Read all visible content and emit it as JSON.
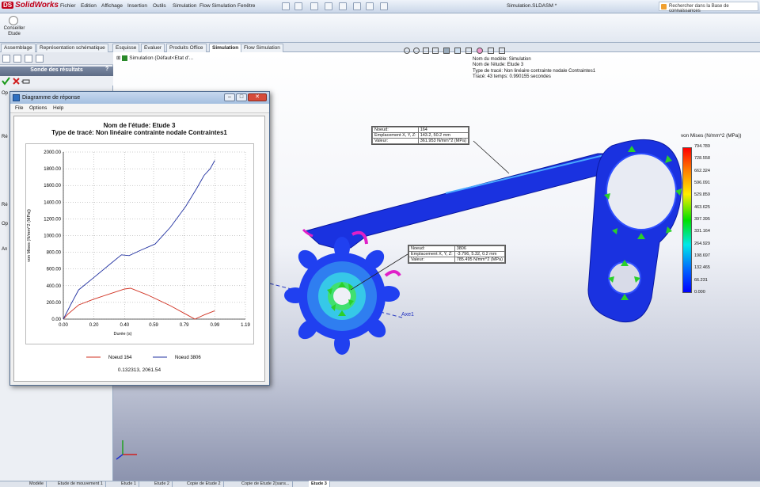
{
  "app": {
    "brand": "SolidWorks",
    "document_title": "Simulation.SLDASM *",
    "menu": [
      "Fichier",
      "Edition",
      "Affichage",
      "Insertion",
      "Outils",
      "Simulation",
      "Flow Simulation",
      "Fenêtre"
    ],
    "search_placeholder": "Rechercher dans la Base de connaissances",
    "advisor_label": "Conseiller Etude"
  },
  "tabs": [
    "Assemblage",
    "Représentation schématique",
    "Esquisse",
    "Evaluer",
    "Produits Office",
    "Simulation",
    "Flow Simulation"
  ],
  "active_tab": "Simulation",
  "left_panel": {
    "probe_title": "Sonde des résultats",
    "help": "?",
    "side_letters": [
      "Op",
      "Ré",
      "Ré",
      "Op",
      "An"
    ]
  },
  "tree": {
    "root_label": "Simulation  (Défaut<Etat d'..."
  },
  "model_info": [
    "Nom du modèle: Simulation",
    "Nom de l'étude: Etude 3",
    "Type de tracé: Non linéaire contrainte nodale Contraintes1",
    "Tracé: 43    temps: 0.990155 secondes"
  ],
  "legend": {
    "title": "von Mises (N/mm^2 (MPa))",
    "values": [
      "794.789",
      "728.558",
      "662.324",
      "596.091",
      "529.859",
      "463.625",
      "397.395",
      "331.164",
      "264.929",
      "198.697",
      "132.465",
      "66.231",
      "0.000"
    ]
  },
  "callout1": {
    "rows": [
      [
        "Noeud:",
        "164"
      ],
      [
        "Emplacement X, Y, Z:",
        "143.2, 50.2 mm"
      ],
      [
        "Valeur:",
        "361.953   N/mm^2 (MPa)"
      ]
    ]
  },
  "callout2": {
    "rows": [
      [
        "Noeud:",
        "3806"
      ],
      [
        "Emplacement X, Y, Z:",
        "-3.796, 5.32, 0.2 mm"
      ],
      [
        "Valeur:",
        "785.495   N/mm^2 (MPa)"
      ]
    ]
  },
  "axis_label": "Axe1",
  "dialog": {
    "title": "Diagramme de réponse",
    "menu": [
      "File",
      "Options",
      "Help"
    ],
    "footer_value": "0.132313, 2061.54"
  },
  "chart_data": {
    "type": "line",
    "title": "Nom de l'étude: Etude 3",
    "subtitle": "Type de tracé: Non linéaire contrainte nodale Contraintes1",
    "xlabel": "Durée (s)",
    "ylabel": "von Mises (N/mm^2 (MPa))",
    "xlim": [
      0,
      1.19
    ],
    "ylim": [
      0,
      2000
    ],
    "x_ticks": [
      "0.00",
      "0.20",
      "0.40",
      "0.59",
      "0.79",
      "0.99",
      "1.19"
    ],
    "y_ticks": [
      "0.00",
      "200.00",
      "400.00",
      "600.00",
      "800.00",
      "1000.00",
      "1200.00",
      "1400.00",
      "1600.00",
      "1800.00",
      "2000.00"
    ],
    "grid": true,
    "legend_position": "bottom",
    "series": [
      {
        "name": "Noeud 164",
        "color": "#d03020",
        "points": [
          [
            0.0,
            0
          ],
          [
            0.03,
            60
          ],
          [
            0.1,
            170
          ],
          [
            0.2,
            240
          ],
          [
            0.3,
            300
          ],
          [
            0.4,
            360
          ],
          [
            0.44,
            370
          ],
          [
            0.55,
            290
          ],
          [
            0.7,
            160
          ],
          [
            0.8,
            60
          ],
          [
            0.86,
            0
          ],
          [
            0.92,
            50
          ],
          [
            0.99,
            100
          ]
        ]
      },
      {
        "name": "Noeud 3806",
        "color": "#2030a0",
        "points": [
          [
            0.0,
            0
          ],
          [
            0.05,
            180
          ],
          [
            0.1,
            350
          ],
          [
            0.2,
            500
          ],
          [
            0.3,
            650
          ],
          [
            0.38,
            770
          ],
          [
            0.43,
            760
          ],
          [
            0.5,
            820
          ],
          [
            0.6,
            900
          ],
          [
            0.7,
            1100
          ],
          [
            0.8,
            1350
          ],
          [
            0.87,
            1560
          ],
          [
            0.92,
            1720
          ],
          [
            0.96,
            1800
          ],
          [
            0.99,
            1900
          ]
        ]
      }
    ]
  },
  "bottom_tabs": [
    "Modèle",
    "Etude de mouvement 1",
    "Etude 1",
    "Etude 2",
    "Copie de Etude 2",
    "Copie de Etude 2(sans...",
    "Etude 3"
  ],
  "active_bottom_tab": "Etude 3",
  "colors": {
    "part_blue": "#1530e0",
    "arrow_green": "#2ad02a",
    "fixture_magenta": "#e020c8"
  }
}
